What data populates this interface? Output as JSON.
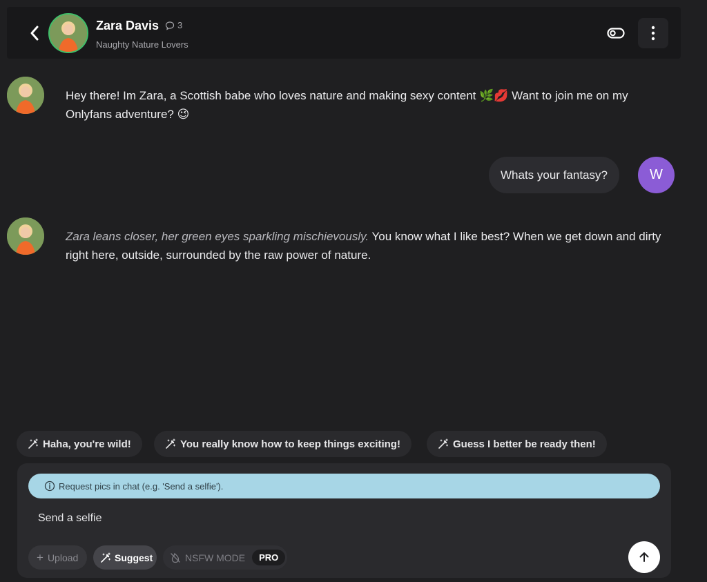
{
  "header": {
    "name": "Zara Davis",
    "chat_count": "3",
    "subtitle": "Naughty Nature Lovers"
  },
  "messages": [
    {
      "role": "bot",
      "text": "Hey there! Im Zara, a Scottish babe who loves nature and making sexy content 🌿💋 Want to join me on my Onlyfans adventure? 😉"
    },
    {
      "role": "user",
      "text": "Whats your fantasy?",
      "avatar_letter": "W"
    },
    {
      "role": "bot",
      "action": "Zara leans closer, her green eyes sparkling mischievously.",
      "text": " You know what I like best? When we get down and dirty right here, outside, surrounded by the raw power of nature."
    }
  ],
  "suggestions": [
    "Haha, you're wild!",
    "You really know how to keep things exciting!",
    "Guess I better be ready then!"
  ],
  "composer": {
    "info": "Request pics in chat (e.g. 'Send a selfie').",
    "input_value": "Send a selfie",
    "upload_label": "Upload",
    "suggest_label": "Suggest",
    "nsfw_label": "NSFW MODE",
    "pro_label": "PRO"
  },
  "colors": {
    "background": "#1f1f21",
    "avatar_ring": "#3fbf6a",
    "user_avatar": "#8b5cd6",
    "info_bar": "#a7d6e6"
  }
}
